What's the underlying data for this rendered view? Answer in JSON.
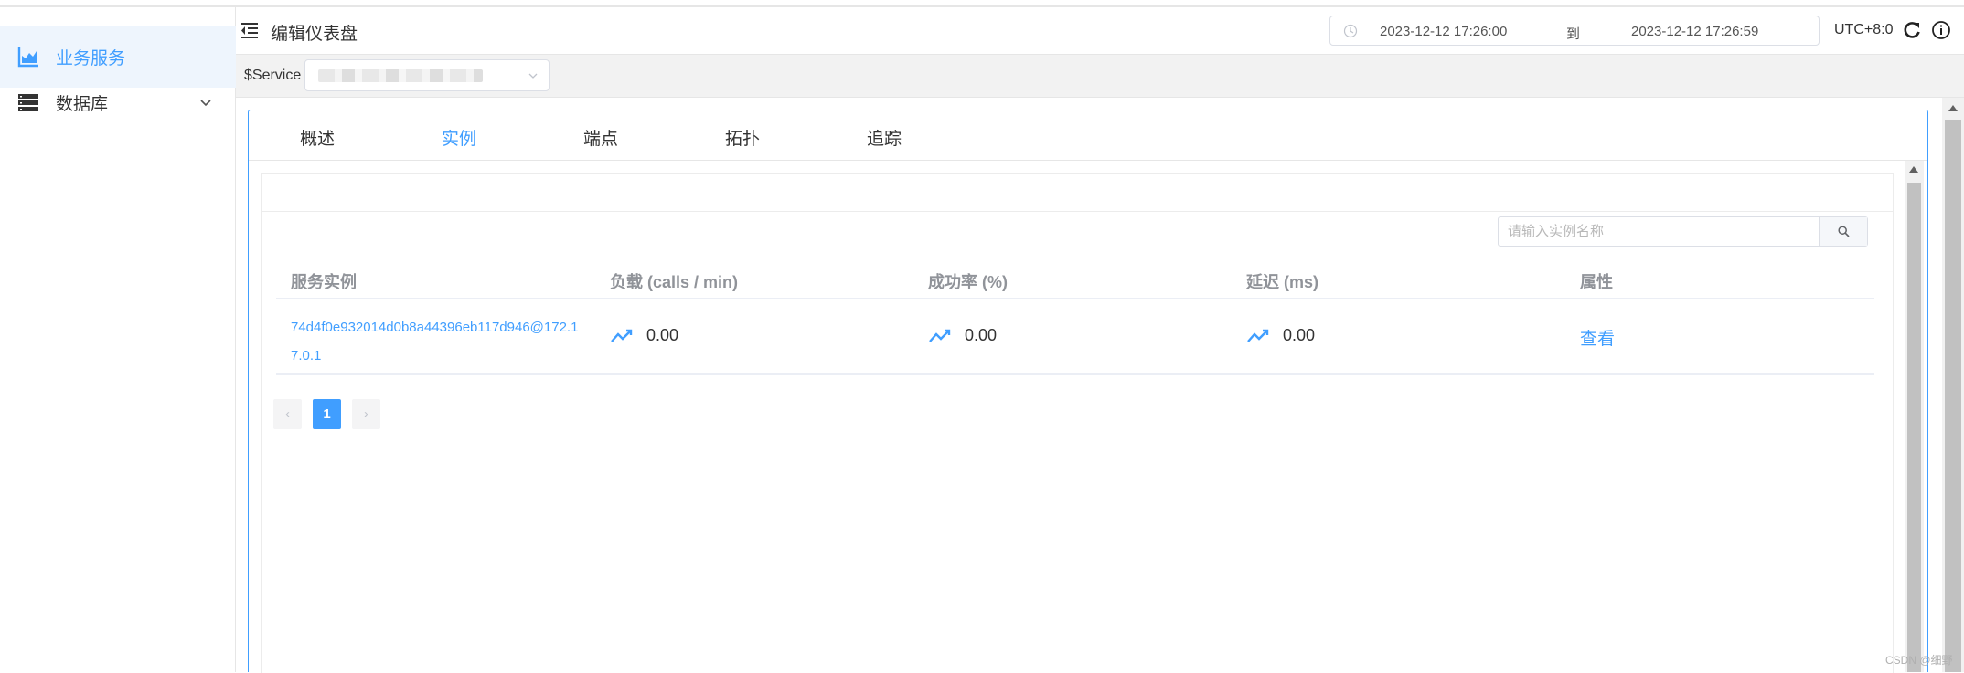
{
  "sidebar": {
    "items": [
      {
        "label": "业务服务",
        "icon": "area-chart-icon",
        "active": true
      },
      {
        "label": "数据库",
        "icon": "database-icon",
        "active": false
      }
    ]
  },
  "header": {
    "title": "编辑仪表盘",
    "time_start": "2023-12-12 17:26:00",
    "time_separator": "到",
    "time_end": "2023-12-12 17:26:59",
    "timezone": "UTC+8:0"
  },
  "filter": {
    "service_label": "$Service"
  },
  "tabs": [
    {
      "label": "概述",
      "active": false
    },
    {
      "label": "实例",
      "active": true
    },
    {
      "label": "端点",
      "active": false
    },
    {
      "label": "拓扑",
      "active": false
    },
    {
      "label": "追踪",
      "active": false
    }
  ],
  "search": {
    "placeholder": "请输入实例名称",
    "value": ""
  },
  "table": {
    "columns": [
      "服务实例",
      "负载 (calls / min)",
      "成功率 (%)",
      "延迟 (ms)",
      "属性"
    ],
    "rows": [
      {
        "instance": "74d4f0e932014d0b8a44396eb117d946@172.17.0.1",
        "load": "0.00",
        "success_rate": "0.00",
        "latency": "0.00",
        "action": "查看"
      }
    ]
  },
  "pagination": {
    "current_page": "1",
    "prev": "‹",
    "next": "›"
  },
  "watermark": "CSDN @细野",
  "colors": {
    "accent": "#409eff",
    "sidebar_active_bg": "#eef5fd",
    "filterbar_bg": "#f2f2f2"
  }
}
